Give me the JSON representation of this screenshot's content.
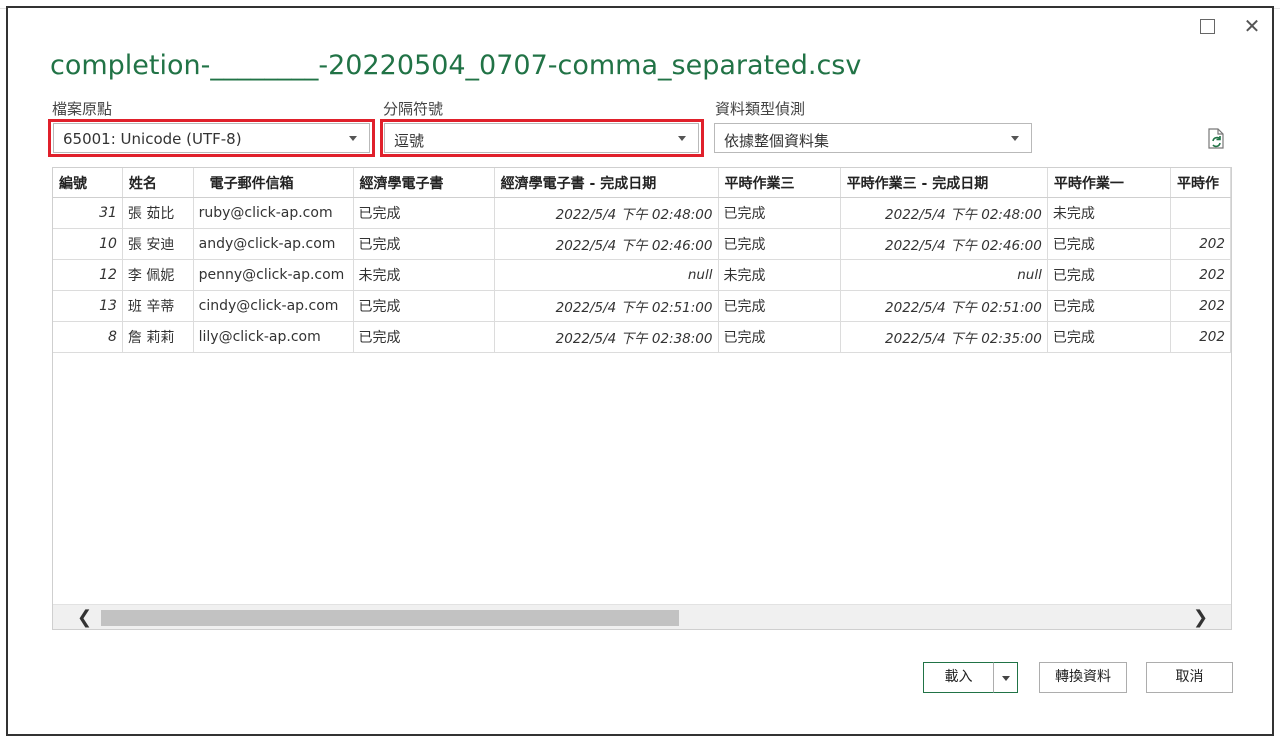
{
  "dialog": {
    "title": "completion-________-20220504_0707-comma_separated.csv"
  },
  "window_controls": {
    "maximize_icon": "maximize-icon",
    "close_icon": "close-icon",
    "close_glyph": "✕"
  },
  "file_origin": {
    "label": "檔案原點",
    "value": "65001: Unicode (UTF-8)"
  },
  "delimiter": {
    "label": "分隔符號",
    "value": "逗號"
  },
  "type_detection": {
    "label": "資料類型偵測",
    "value": "依據整個資料集"
  },
  "highlight_color": "#e0202b",
  "accent_color": "#217346",
  "preview": {
    "columns": [
      "編號",
      "姓名",
      "電子郵件信箱",
      "經濟學電子書",
      "經濟學電子書 - 完成日期",
      "平時作業三",
      "平時作業三 - 完成日期",
      "平時作業一",
      "平時作"
    ],
    "rows": [
      [
        "31",
        "張 茹比",
        "ruby@click-ap.com",
        "已完成",
        "2022/5/4 下午 02:48:00",
        "已完成",
        "2022/5/4 下午 02:48:00",
        "未完成",
        ""
      ],
      [
        "10",
        "張 安迪",
        "andy@click-ap.com",
        "已完成",
        "2022/5/4 下午 02:46:00",
        "已完成",
        "2022/5/4 下午 02:46:00",
        "已完成",
        "202"
      ],
      [
        "12",
        "李 佩妮",
        "penny@click-ap.com",
        "未完成",
        "null",
        "未完成",
        "null",
        "已完成",
        "202"
      ],
      [
        "13",
        "班 辛蒂",
        "cindy@click-ap.com",
        "已完成",
        "2022/5/4 下午 02:51:00",
        "已完成",
        "2022/5/4 下午 02:51:00",
        "已完成",
        "202"
      ],
      [
        "8",
        "詹 莉莉",
        "lily@click-ap.com",
        "已完成",
        "2022/5/4 下午 02:38:00",
        "已完成",
        "2022/5/4 下午 02:35:00",
        "已完成",
        "202"
      ]
    ]
  },
  "scrollbar": {
    "left_glyph": "❮",
    "right_glyph": "❯"
  },
  "buttons": {
    "load": "載入",
    "transform": "轉換資料",
    "cancel": "取消"
  }
}
